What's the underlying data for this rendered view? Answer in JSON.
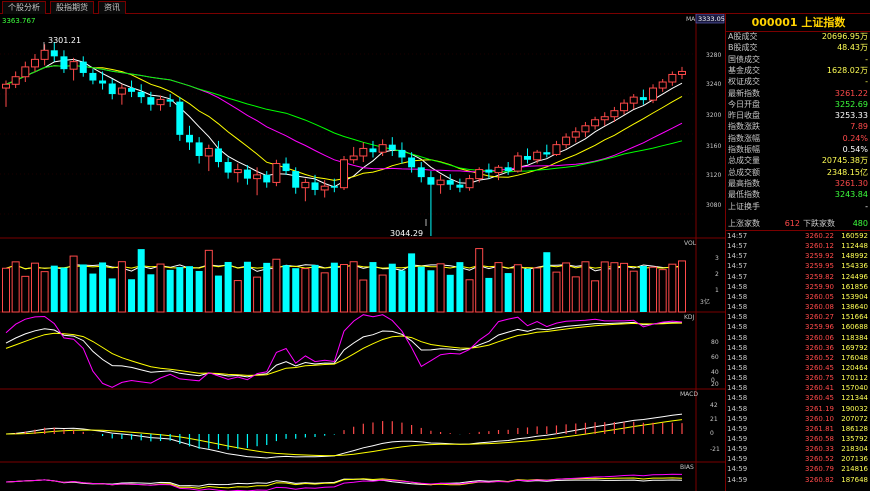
{
  "tabs": [
    "个股分析",
    "股指期货",
    "资讯"
  ],
  "chart": {
    "top_left_value": "3363.767",
    "ma_label": "MA",
    "current_price_tag": "3333.05",
    "high_annotation": "3301.21",
    "low_annotation": "3044.29",
    "price_axis": [
      "3280",
      "3240",
      "3200",
      "3160",
      "3120",
      "3080"
    ],
    "vol_label": "VOL",
    "vol_axis": [
      "3",
      "2",
      "1"
    ],
    "vol_unit": "3亿",
    "kdj_label": "KDJ",
    "kdj_axis": [
      "80",
      "60",
      "40",
      "20",
      "0"
    ],
    "macd_label": "MACD",
    "macd_axis": [
      "42",
      "21",
      "0",
      "-21"
    ],
    "bias_label": "BIAS"
  },
  "panel": {
    "code": "000001",
    "name": "上证指数",
    "rows": [
      {
        "label": "A股成交",
        "value": "20696.95万",
        "color": "#ffff55"
      },
      {
        "label": "B股成交",
        "value": "48.43万",
        "color": "#ffff55"
      },
      {
        "label": "国债成交",
        "value": "-",
        "color": "#ffff55"
      },
      {
        "label": "基金成交",
        "value": "1628.02万",
        "color": "#ffff55"
      },
      {
        "label": "权证成交",
        "value": "-",
        "color": "#ffff55"
      },
      {
        "label": "最新指数",
        "value": "3261.22",
        "color": "#ff4a4a"
      },
      {
        "label": "今日开盘",
        "value": "3252.69",
        "color": "#3cff3c"
      },
      {
        "label": "昨日收盘",
        "value": "3253.33",
        "color": "#ffffff"
      },
      {
        "label": "指数涨跌",
        "value": "7.89",
        "color": "#ff4a4a"
      },
      {
        "label": "指数涨幅",
        "value": "0.24%",
        "color": "#ff4a4a"
      },
      {
        "label": "指数振幅",
        "value": "0.54%",
        "color": "#ffffff"
      },
      {
        "label": "总成交量",
        "value": "20745.38万",
        "color": "#ffff55"
      },
      {
        "label": "总成交额",
        "value": "2348.15亿",
        "color": "#ffff55"
      },
      {
        "label": "最高指数",
        "value": "3261.30",
        "color": "#ff4a4a"
      },
      {
        "label": "最低指数",
        "value": "3243.84",
        "color": "#3cff3c"
      },
      {
        "label": "上证换手",
        "value": "-",
        "color": "#ffffff"
      }
    ],
    "updown": {
      "up_label": "上涨家数",
      "up_value": "612",
      "down_label": "下跌家数",
      "down_value": "480"
    },
    "ticks": [
      {
        "t": "14:57",
        "p": "3260.22",
        "v": "160592"
      },
      {
        "t": "14:57",
        "p": "3260.12",
        "v": "112448"
      },
      {
        "t": "14:57",
        "p": "3259.92",
        "v": "148992"
      },
      {
        "t": "14:57",
        "p": "3259.95",
        "v": "154336"
      },
      {
        "t": "14:57",
        "p": "3259.82",
        "v": "124496"
      },
      {
        "t": "14:58",
        "p": "3259.90",
        "v": "161856"
      },
      {
        "t": "14:58",
        "p": "3260.05",
        "v": "153904"
      },
      {
        "t": "14:58",
        "p": "3260.08",
        "v": "138640"
      },
      {
        "t": "14:58",
        "p": "3260.27",
        "v": "151664"
      },
      {
        "t": "14:58",
        "p": "3259.96",
        "v": "160688"
      },
      {
        "t": "14:58",
        "p": "3260.06",
        "v": "118384"
      },
      {
        "t": "14:58",
        "p": "3260.36",
        "v": "169792"
      },
      {
        "t": "14:58",
        "p": "3260.52",
        "v": "176048"
      },
      {
        "t": "14:58",
        "p": "3260.45",
        "v": "120464"
      },
      {
        "t": "14:58",
        "p": "3260.75",
        "v": "170112"
      },
      {
        "t": "14:58",
        "p": "3260.41",
        "v": "157040"
      },
      {
        "t": "14:58",
        "p": "3260.45",
        "v": "121344"
      },
      {
        "t": "14:58",
        "p": "3261.19",
        "v": "190032"
      },
      {
        "t": "14:59",
        "p": "3260.10",
        "v": "207072"
      },
      {
        "t": "14:59",
        "p": "3261.81",
        "v": "186128"
      },
      {
        "t": "14:59",
        "p": "3260.58",
        "v": "135792"
      },
      {
        "t": "14:59",
        "p": "3260.33",
        "v": "218304"
      },
      {
        "t": "14:59",
        "p": "3260.52",
        "v": "207136"
      },
      {
        "t": "14:59",
        "p": "3260.79",
        "v": "214816"
      },
      {
        "t": "14:59",
        "p": "3260.82",
        "v": "187648"
      }
    ]
  }
}
